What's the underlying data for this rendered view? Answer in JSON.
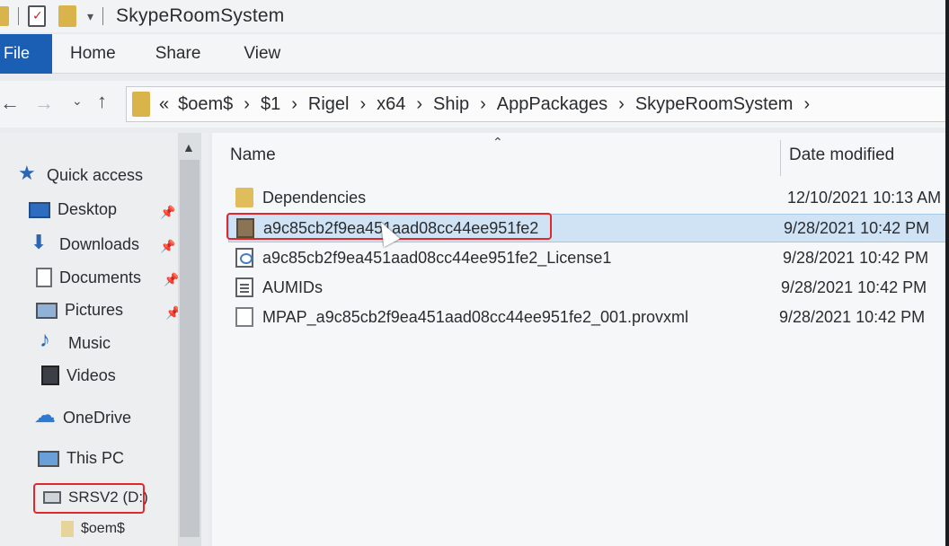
{
  "window": {
    "title": "SkypeRoomSystem"
  },
  "ribbon": {
    "tabs": [
      "File",
      "Home",
      "Share",
      "View"
    ]
  },
  "address_bar": {
    "overflow": "«",
    "crumbs": [
      "$oem$",
      "$1",
      "Rigel",
      "x64",
      "Ship",
      "AppPackages",
      "SkypeRoomSystem"
    ]
  },
  "nav_pane": {
    "items": [
      {
        "label": "Quick access",
        "icon": "star-icon"
      },
      {
        "label": "Desktop",
        "icon": "desktop-icon",
        "pinned": true
      },
      {
        "label": "Downloads",
        "icon": "downloads-icon",
        "pinned": true
      },
      {
        "label": "Documents",
        "icon": "documents-icon",
        "pinned": true
      },
      {
        "label": "Pictures",
        "icon": "pictures-icon",
        "pinned": true
      },
      {
        "label": "Music",
        "icon": "music-icon"
      },
      {
        "label": "Videos",
        "icon": "videos-icon"
      },
      {
        "label": "OneDrive",
        "icon": "onedrive-icon"
      },
      {
        "label": "This PC",
        "icon": "this-pc-icon"
      },
      {
        "label": "SRSV2 (D:)",
        "icon": "drive-icon",
        "highlighted": true
      },
      {
        "label": "$oem$",
        "icon": "folder-icon"
      }
    ]
  },
  "file_list": {
    "columns": [
      "Name",
      "Date modified"
    ],
    "rows": [
      {
        "name": "Dependencies",
        "date": "12/10/2021 10:13 AM",
        "icon": "folder-icon"
      },
      {
        "name": "a9c85cb2f9ea451aad08cc44ee951fe2",
        "date": "9/28/2021 10:42 PM",
        "icon": "package-icon",
        "selected": true,
        "highlighted": true
      },
      {
        "name": "a9c85cb2f9ea451aad08cc44ee951fe2_License1",
        "date": "9/28/2021 10:42 PM",
        "icon": "license-file-icon"
      },
      {
        "name": "AUMIDs",
        "date": "9/28/2021 10:42 PM",
        "icon": "text-file-icon"
      },
      {
        "name": "MPAP_a9c85cb2f9ea451aad08cc44ee951fe2_001.provxml",
        "date": "9/28/2021 10:42 PM",
        "icon": "file-icon"
      }
    ]
  },
  "colors": {
    "file_tab": "#1a5fb4",
    "selection": "#cfe3f5",
    "highlight_outline": "#e2282d",
    "folder": "#e0bc5a"
  }
}
